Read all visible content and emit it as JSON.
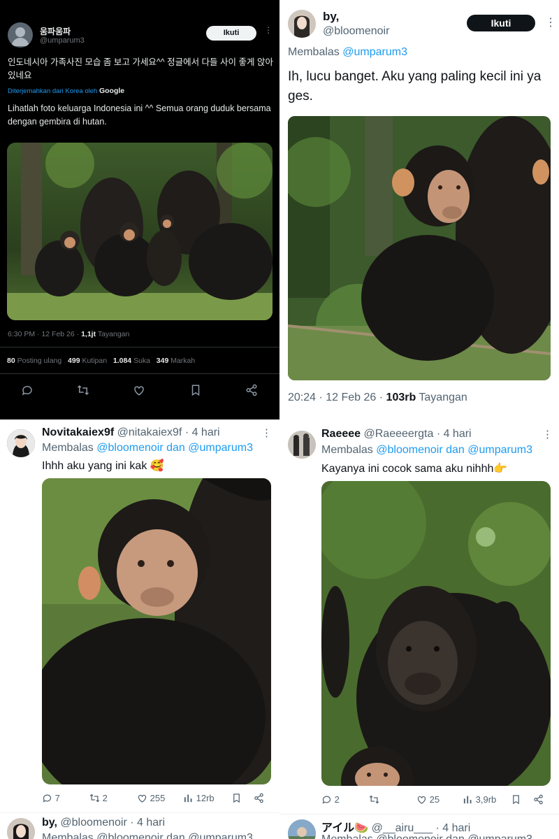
{
  "tweet_main": {
    "display_name": "움파움파",
    "handle": "@umparum3",
    "follow_label": "Ikuti",
    "text_korean": "인도네시아 가족사진 모습 좀 보고 가세요^^ 정글에서 다들 사이 좋게 앉아있네요",
    "translated_by": "Diterjemahkan dari Korea oleh",
    "translator": "Google",
    "text_translated": "Lihatlah foto keluarga Indonesia ini ^^ Semua orang duduk bersama dengan gembira di hutan.",
    "timestamp": "6:30 PM · 12 Feb 26 ·",
    "views_count": "1,1jt",
    "views_label": "Tayangan",
    "stats": [
      {
        "count": "80",
        "label": "Posting ulang"
      },
      {
        "count": "499",
        "label": "Kutipan"
      },
      {
        "count": "1.084",
        "label": "Suka"
      },
      {
        "count": "349",
        "label": "Markah"
      }
    ],
    "actions": [
      "reply-icon",
      "retweet-icon",
      "like-icon",
      "bookmark-icon",
      "share-icon"
    ],
    "image_alt": "chimpanzee family sitting together in a forest"
  },
  "reply_bloomenoir": {
    "display_name": "by,",
    "handle": "@bloomenoir",
    "follow_label": "Ikuti",
    "replying_label": "Membalas",
    "replying_to": "@umparum3",
    "text": "Ih, lucu banget. Aku yang paling kecil ini ya ges.",
    "timestamp": "20:24 · 12 Feb 26 ·",
    "views_count": "103rb",
    "views_label": "Tayangan",
    "image_alt": "young chimpanzee in the forest"
  },
  "reply_novita": {
    "display_name": "Novitakaiex9f",
    "handle": "@nitakaiex9f",
    "time": "· 4 hari",
    "replying_label": "Membalas",
    "replying_to": "@bloomenoir dan @umparum3",
    "text": "Ihhh aku yang ini kak 🥰",
    "image_alt": "baby chimpanzee close-up",
    "replies": "7",
    "reposts": "2",
    "likes": "255",
    "views": "12rb"
  },
  "reply_raeeee": {
    "display_name": "Raeeee",
    "handle": "@Raeeeergta",
    "time": "· 4 hari",
    "replying_label": "Membalas",
    "replying_to": "@bloomenoir dan @umparum3",
    "text": "Kayanya ini cocok sama aku nihhh👉",
    "image_alt": "adult chimpanzee portrait",
    "replies": "2",
    "reposts": "",
    "likes": "25",
    "views": "3,9rb"
  },
  "next_reply_left": {
    "display_name": "by,",
    "handle": "@bloomenoir",
    "time": "· 4 hari",
    "replying_partial": "Membalas @bloomenoir dan @umparum3"
  },
  "next_reply_right": {
    "display_name": "アイル🍉",
    "handle": "@__airu___",
    "time": "· 4 hari",
    "replying_partial": "Membalas @bloomenoir dan @umparum3"
  },
  "colors": {
    "link_blue": "#1d9bf0",
    "dark_bg": "#000000",
    "gray_text": "#536471",
    "follow_dark": "#0f1419"
  }
}
